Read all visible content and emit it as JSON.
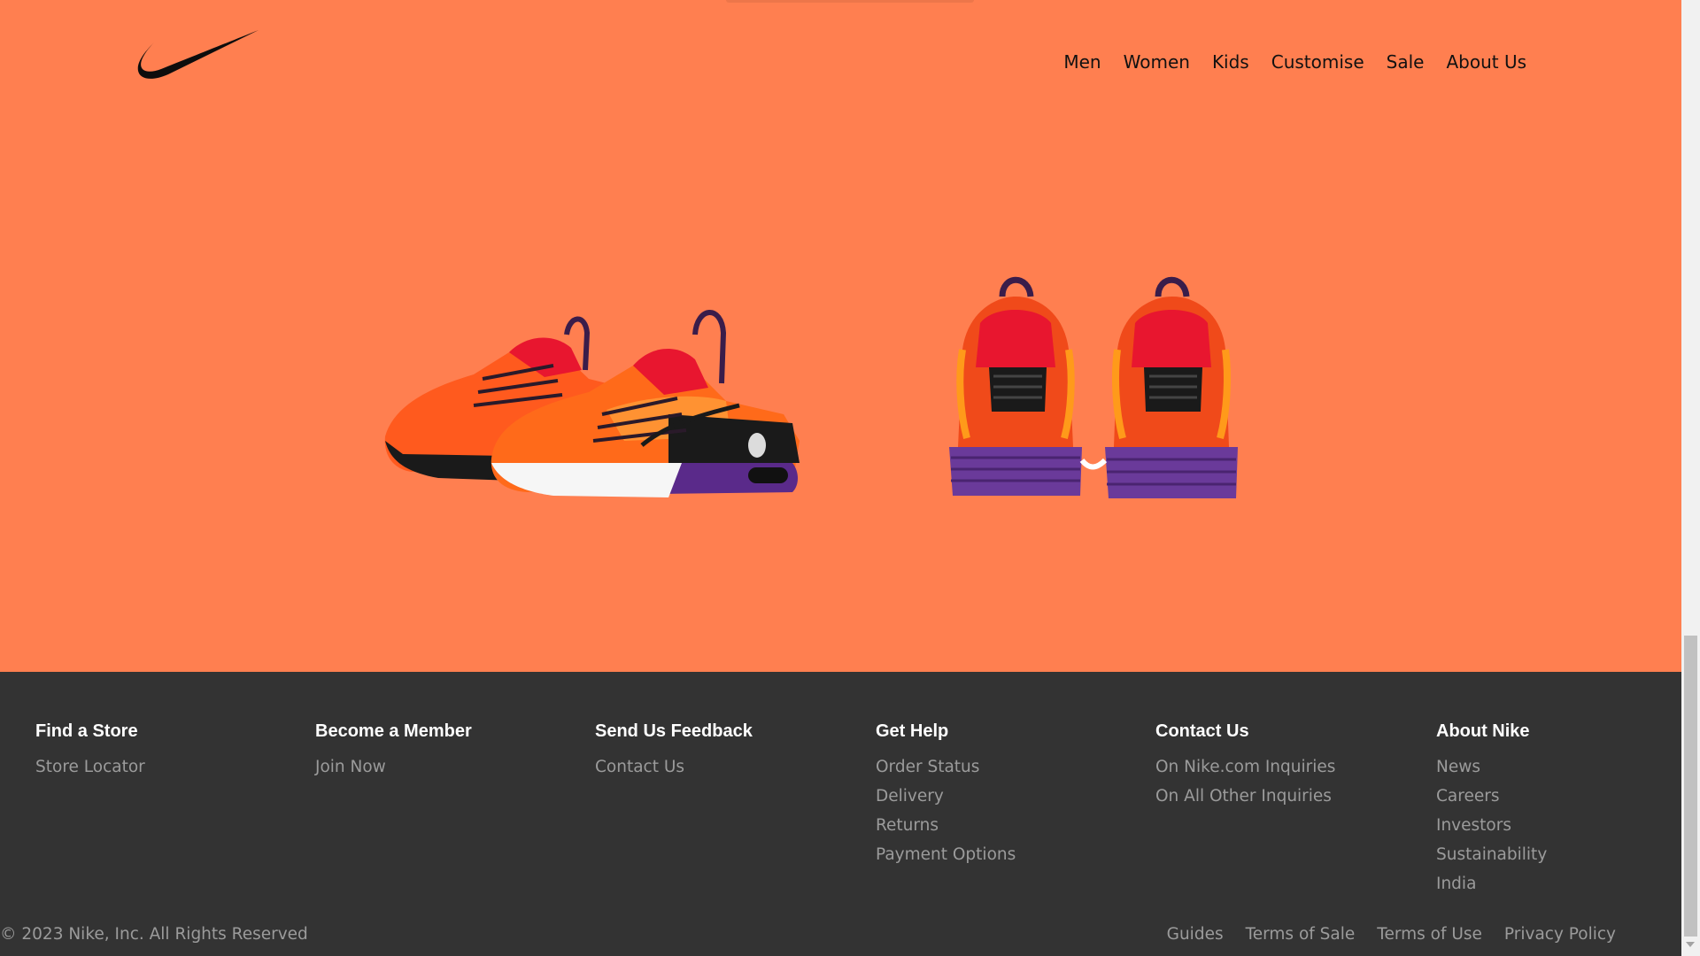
{
  "brand": {
    "logo": "swoosh-logo"
  },
  "nav": {
    "items": [
      "Men",
      "Women",
      "Kids",
      "Customise",
      "Sale",
      "About Us"
    ]
  },
  "products": [
    {
      "name": "shoe-side-view"
    },
    {
      "name": "shoe-back-view"
    }
  ],
  "footer": {
    "columns": [
      {
        "title": "Find a Store",
        "links": [
          "Store Locator"
        ]
      },
      {
        "title": "Become a Member",
        "links": [
          "Join Now"
        ]
      },
      {
        "title": "Send Us Feedback",
        "links": [
          "Contact Us"
        ]
      },
      {
        "title": "Get Help",
        "links": [
          "Order Status",
          "Delivery",
          "Returns",
          "Payment Options"
        ]
      },
      {
        "title": "Contact Us",
        "links": [
          "On Nike.com Inquiries",
          "On All Other Inquiries"
        ]
      },
      {
        "title": "About Nike",
        "links": [
          "News",
          "Careers",
          "Investors",
          "Sustainability",
          "India"
        ]
      }
    ],
    "copyright": "© 2023 Nike, Inc. All Rights Reserved",
    "legal_links": [
      "Guides",
      "Terms of Sale",
      "Terms of Use",
      "Privacy Policy"
    ]
  },
  "colors": {
    "hero_bg": "#ff7f50",
    "footer_bg": "#333333",
    "footer_title": "#ffffff",
    "footer_link": "#9b9b9b"
  }
}
